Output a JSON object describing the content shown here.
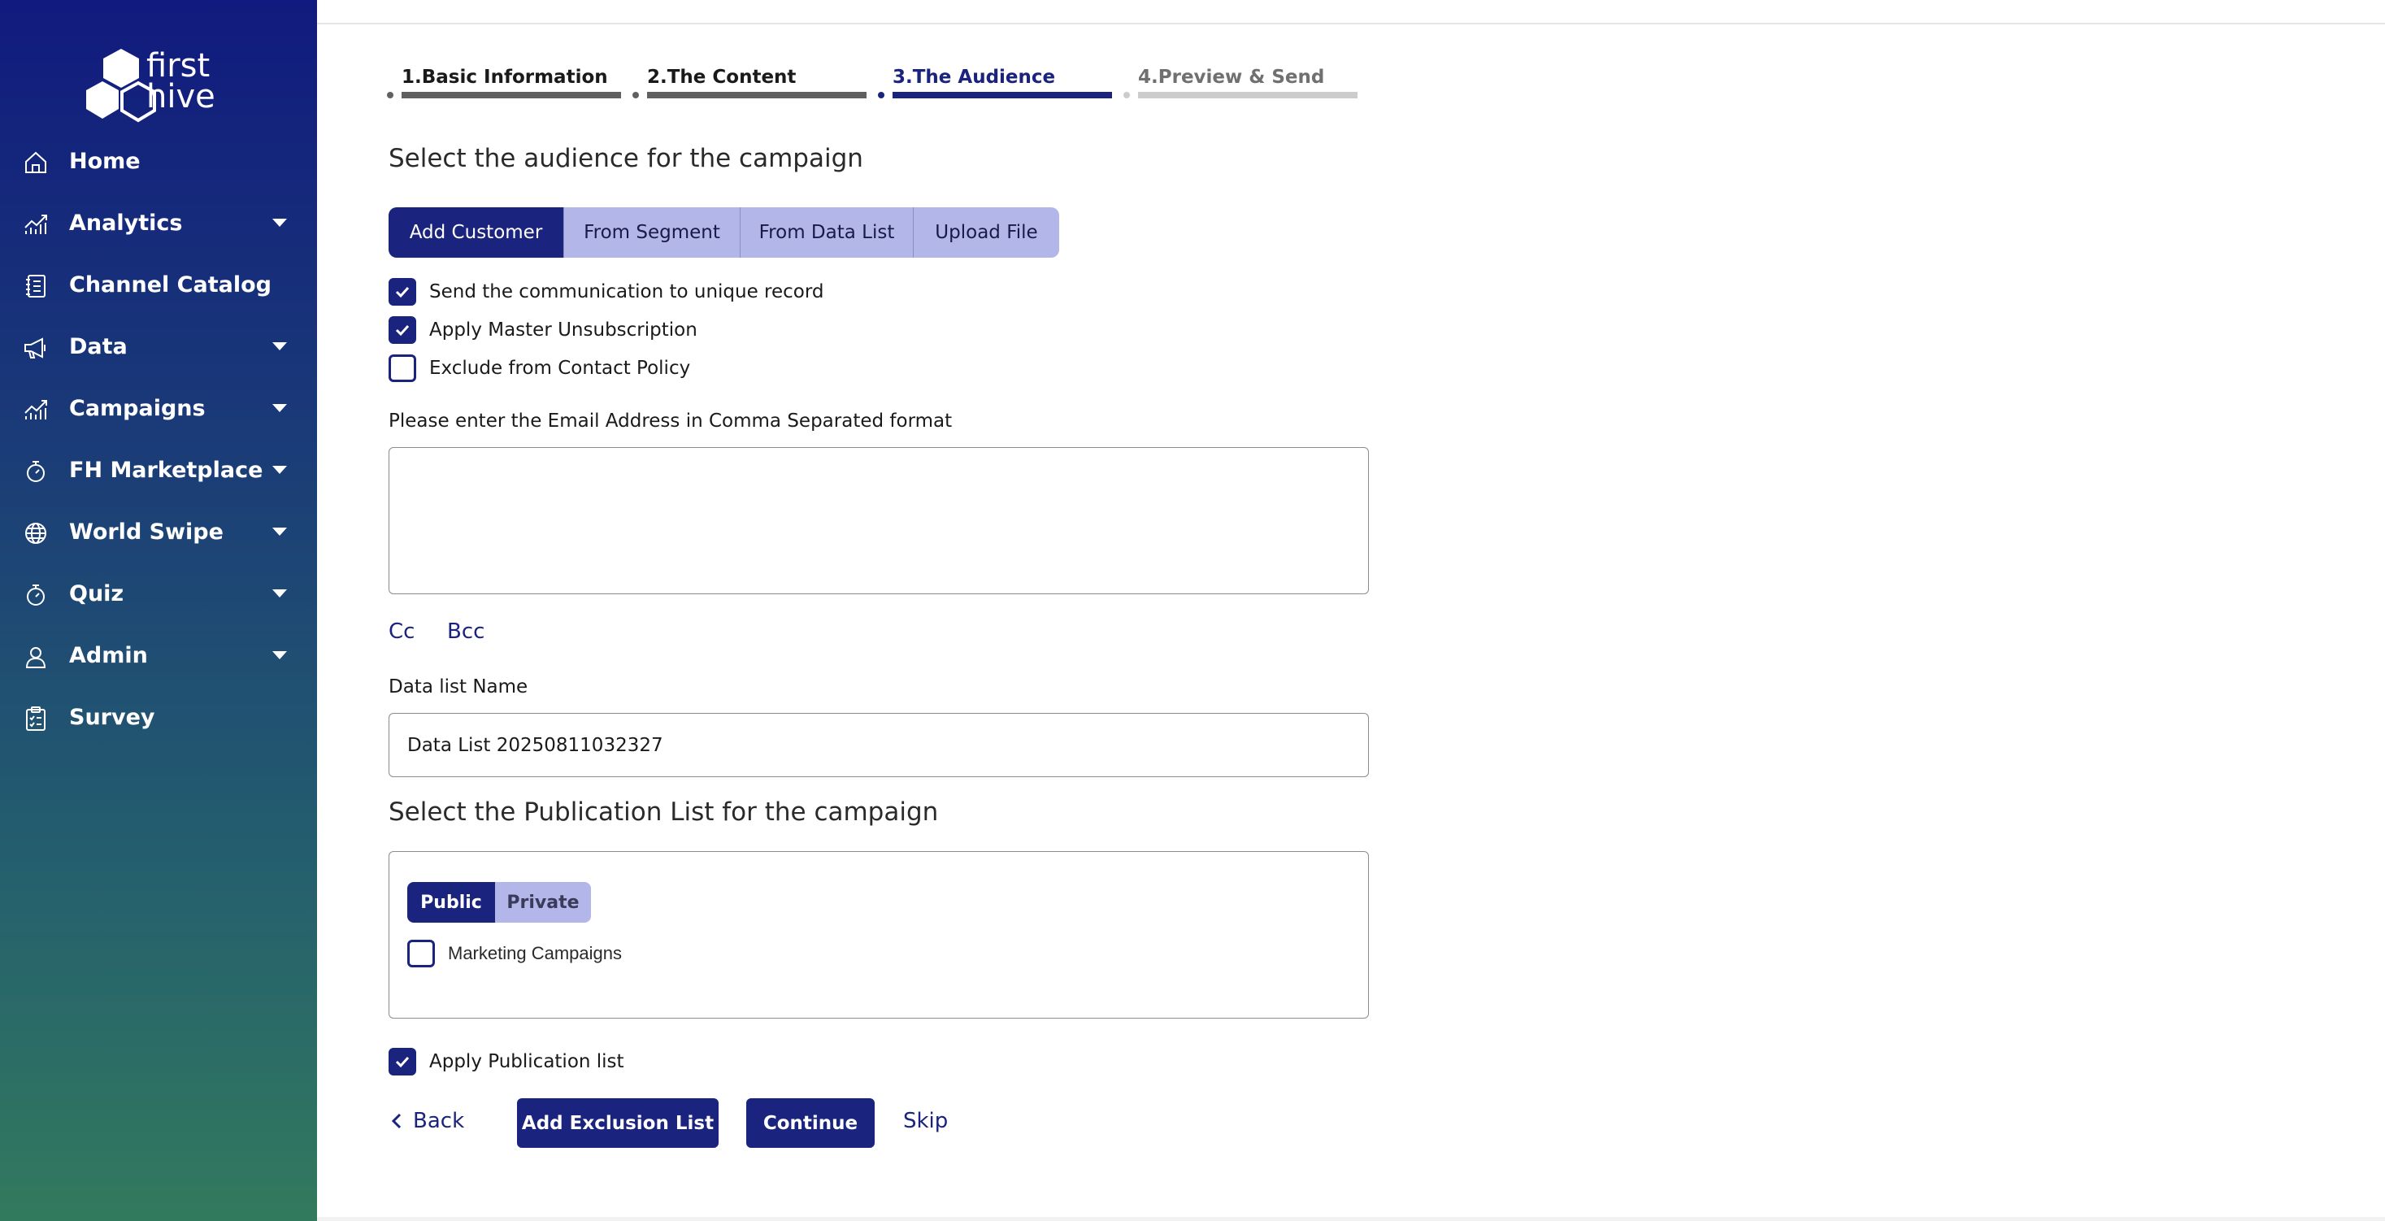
{
  "brand": {
    "logo_text_line1": "first",
    "logo_text_line2": "hive"
  },
  "sidebar": {
    "items": [
      {
        "label": "Home",
        "icon": "home-icon",
        "has_caret": false
      },
      {
        "label": "Analytics",
        "icon": "analytics-icon",
        "has_caret": true
      },
      {
        "label": "Channel Catalog",
        "icon": "catalog-icon",
        "has_caret": false
      },
      {
        "label": "Data",
        "icon": "megaphone-icon",
        "has_caret": true
      },
      {
        "label": "Campaigns",
        "icon": "campaigns-icon",
        "has_caret": true
      },
      {
        "label": "FH Marketplace",
        "icon": "stopwatch-icon",
        "has_caret": true
      },
      {
        "label": "World Swipe",
        "icon": "globe-icon",
        "has_caret": true
      },
      {
        "label": "Quiz",
        "icon": "timer-icon",
        "has_caret": true
      },
      {
        "label": "Admin",
        "icon": "user-icon",
        "has_caret": true
      },
      {
        "label": "Survey",
        "icon": "clipboard-icon",
        "has_caret": false
      }
    ]
  },
  "stepper": {
    "steps": [
      {
        "label": "1.Basic Information",
        "state": "done"
      },
      {
        "label": "2.The Content",
        "state": "done"
      },
      {
        "label": "3.The Audience",
        "state": "active"
      },
      {
        "label": "4.Preview & Send",
        "state": "pending"
      }
    ]
  },
  "audience": {
    "heading": "Select the audience for the campaign",
    "tabs": [
      {
        "label": "Add Customer",
        "active": true
      },
      {
        "label": "From Segment",
        "active": false
      },
      {
        "label": "From Data List",
        "active": false
      },
      {
        "label": "Upload File",
        "active": false
      }
    ],
    "options": [
      {
        "label": "Send the communication to unique record",
        "checked": true
      },
      {
        "label": "Apply Master Unsubscription",
        "checked": true
      },
      {
        "label": "Exclude from Contact Policy",
        "checked": false
      }
    ],
    "email_label": "Please enter the Email Address in Comma Separated format",
    "email_value": "",
    "cc_label": "Cc",
    "bcc_label": "Bcc",
    "datalist_label": "Data list Name",
    "datalist_value": "Data List 20250811032327"
  },
  "publication": {
    "heading": "Select the Publication List for the campaign",
    "tabs": [
      {
        "label": "Public",
        "active": true
      },
      {
        "label": "Private",
        "active": false
      }
    ],
    "items": [
      {
        "label": "Marketing Campaigns",
        "checked": false
      }
    ],
    "apply_label": "Apply Publication list",
    "apply_checked": true
  },
  "actions": {
    "back_label": "Back",
    "exclusion_label": "Add Exclusion List",
    "continue_label": "Continue",
    "skip_label": "Skip"
  },
  "colors": {
    "primary": "#1a237e",
    "tab_inactive": "#b3b6e9",
    "sidebar_top": "#111a7e",
    "sidebar_bottom": "#327a5e"
  }
}
